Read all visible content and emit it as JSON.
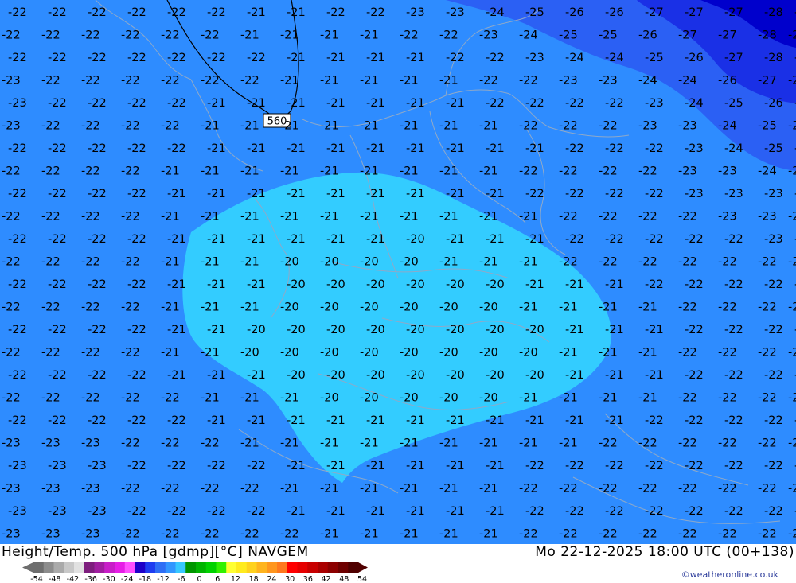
{
  "map": {
    "contour_label": "560",
    "columns": [
      2,
      52,
      102,
      152,
      202,
      252,
      302,
      352,
      402,
      452,
      502,
      552,
      602,
      652,
      702,
      752,
      802,
      852,
      902,
      952,
      990
    ],
    "rows": [
      [
        "-22",
        "-22",
        "-22",
        "-22",
        "-22",
        "-22",
        "-21",
        "-21",
        "-22",
        "-22",
        "-23",
        "-23",
        "-24",
        "-25",
        "-26",
        "-26",
        "-27",
        "-27",
        "-27",
        "-28",
        "-28"
      ],
      [
        "-22",
        "-22",
        "-22",
        "-22",
        "-22",
        "-22",
        "-21",
        "-21",
        "-21",
        "-21",
        "-22",
        "-22",
        "-23",
        "-24",
        "-25",
        "-25",
        "-26",
        "-27",
        "-27",
        "-28",
        "-28"
      ],
      [
        "-22",
        "-22",
        "-22",
        "-22",
        "-22",
        "-22",
        "-22",
        "-21",
        "-21",
        "-21",
        "-21",
        "-22",
        "-22",
        "-23",
        "-24",
        "-24",
        "-25",
        "-26",
        "-27",
        "-28",
        "-28"
      ],
      [
        "-23",
        "-22",
        "-22",
        "-22",
        "-22",
        "-22",
        "-22",
        "-21",
        "-21",
        "-21",
        "-21",
        "-21",
        "-22",
        "-22",
        "-23",
        "-23",
        "-24",
        "-24",
        "-26",
        "-27",
        "-27"
      ],
      [
        "-23",
        "-22",
        "-22",
        "-22",
        "-22",
        "-21",
        "-21",
        "-21",
        "-21",
        "-21",
        "-21",
        "-21",
        "-22",
        "-22",
        "-22",
        "-22",
        "-23",
        "-24",
        "-25",
        "-26",
        "-26"
      ],
      [
        "-23",
        "-22",
        "-22",
        "-22",
        "-22",
        "-21",
        "-21",
        "-21",
        "-21",
        "-21",
        "-21",
        "-21",
        "-21",
        "-22",
        "-22",
        "-22",
        "-23",
        "-23",
        "-24",
        "-25",
        "-26"
      ],
      [
        "-22",
        "-22",
        "-22",
        "-22",
        "-22",
        "-21",
        "-21",
        "-21",
        "-21",
        "-21",
        "-21",
        "-21",
        "-21",
        "-21",
        "-22",
        "-22",
        "-22",
        "-23",
        "-24",
        "-25",
        "-25"
      ],
      [
        "-22",
        "-22",
        "-22",
        "-22",
        "-21",
        "-21",
        "-21",
        "-21",
        "-21",
        "-21",
        "-21",
        "-21",
        "-21",
        "-22",
        "-22",
        "-22",
        "-22",
        "-23",
        "-23",
        "-24",
        "-24"
      ],
      [
        "-22",
        "-22",
        "-22",
        "-22",
        "-21",
        "-21",
        "-21",
        "-21",
        "-21",
        "-21",
        "-21",
        "-21",
        "-21",
        "-22",
        "-22",
        "-22",
        "-22",
        "-23",
        "-23",
        "-23",
        "-23"
      ],
      [
        "-22",
        "-22",
        "-22",
        "-22",
        "-21",
        "-21",
        "-21",
        "-21",
        "-21",
        "-21",
        "-21",
        "-21",
        "-21",
        "-21",
        "-22",
        "-22",
        "-22",
        "-22",
        "-23",
        "-23",
        "-23"
      ],
      [
        "-22",
        "-22",
        "-22",
        "-22",
        "-21",
        "-21",
        "-21",
        "-21",
        "-21",
        "-21",
        "-20",
        "-21",
        "-21",
        "-21",
        "-22",
        "-22",
        "-22",
        "-22",
        "-22",
        "-23",
        "-23"
      ],
      [
        "-22",
        "-22",
        "-22",
        "-22",
        "-21",
        "-21",
        "-21",
        "-20",
        "-20",
        "-20",
        "-20",
        "-21",
        "-21",
        "-21",
        "-22",
        "-22",
        "-22",
        "-22",
        "-22",
        "-22",
        "-23"
      ],
      [
        "-22",
        "-22",
        "-22",
        "-22",
        "-21",
        "-21",
        "-21",
        "-20",
        "-20",
        "-20",
        "-20",
        "-20",
        "-20",
        "-21",
        "-21",
        "-21",
        "-22",
        "-22",
        "-22",
        "-22",
        "-22"
      ],
      [
        "-22",
        "-22",
        "-22",
        "-22",
        "-21",
        "-21",
        "-21",
        "-20",
        "-20",
        "-20",
        "-20",
        "-20",
        "-20",
        "-21",
        "-21",
        "-21",
        "-21",
        "-22",
        "-22",
        "-22",
        "-22"
      ],
      [
        "-22",
        "-22",
        "-22",
        "-22",
        "-21",
        "-21",
        "-20",
        "-20",
        "-20",
        "-20",
        "-20",
        "-20",
        "-20",
        "-20",
        "-21",
        "-21",
        "-21",
        "-22",
        "-22",
        "-22",
        "-22"
      ],
      [
        "-22",
        "-22",
        "-22",
        "-22",
        "-21",
        "-21",
        "-20",
        "-20",
        "-20",
        "-20",
        "-20",
        "-20",
        "-20",
        "-20",
        "-21",
        "-21",
        "-21",
        "-22",
        "-22",
        "-22",
        "-23"
      ],
      [
        "-22",
        "-22",
        "-22",
        "-22",
        "-21",
        "-21",
        "-21",
        "-20",
        "-20",
        "-20",
        "-20",
        "-20",
        "-20",
        "-20",
        "-21",
        "-21",
        "-21",
        "-22",
        "-22",
        "-22",
        "-22"
      ],
      [
        "-22",
        "-22",
        "-22",
        "-22",
        "-22",
        "-21",
        "-21",
        "-21",
        "-20",
        "-20",
        "-20",
        "-20",
        "-20",
        "-21",
        "-21",
        "-21",
        "-21",
        "-22",
        "-22",
        "-22",
        "-22"
      ],
      [
        "-22",
        "-22",
        "-22",
        "-22",
        "-22",
        "-21",
        "-21",
        "-21",
        "-21",
        "-21",
        "-21",
        "-21",
        "-21",
        "-21",
        "-21",
        "-21",
        "-22",
        "-22",
        "-22",
        "-22",
        "-22"
      ],
      [
        "-23",
        "-23",
        "-23",
        "-22",
        "-22",
        "-22",
        "-21",
        "-21",
        "-21",
        "-21",
        "-21",
        "-21",
        "-21",
        "-21",
        "-21",
        "-22",
        "-22",
        "-22",
        "-22",
        "-22",
        "-22"
      ],
      [
        "-23",
        "-23",
        "-23",
        "-22",
        "-22",
        "-22",
        "-22",
        "-21",
        "-21",
        "-21",
        "-21",
        "-21",
        "-21",
        "-22",
        "-22",
        "-22",
        "-22",
        "-22",
        "-22",
        "-22",
        "-22"
      ],
      [
        "-23",
        "-23",
        "-23",
        "-22",
        "-22",
        "-22",
        "-22",
        "-21",
        "-21",
        "-21",
        "-21",
        "-21",
        "-21",
        "-22",
        "-22",
        "-22",
        "-22",
        "-22",
        "-22",
        "-22",
        "-22"
      ],
      [
        "-23",
        "-23",
        "-23",
        "-22",
        "-22",
        "-22",
        "-22",
        "-21",
        "-21",
        "-21",
        "-21",
        "-21",
        "-21",
        "-22",
        "-22",
        "-22",
        "-22",
        "-22",
        "-22",
        "-22",
        "-22"
      ],
      [
        "-23",
        "-23",
        "-23",
        "-22",
        "-22",
        "-22",
        "-22",
        "-22",
        "-21",
        "-21",
        "-21",
        "-21",
        "-21",
        "-22",
        "-22",
        "-22",
        "-22",
        "-22",
        "-22",
        "-22",
        "-22"
      ]
    ],
    "colors": {
      "band_minus_28": "#0000cc",
      "band_minus_26": "#1a30e6",
      "band_minus_24": "#2b60f4",
      "band_minus_22": "#2e8cff",
      "band_minus_20": "#33ccff",
      "land_borders": "#8fa9c8",
      "value_labels": "#000000"
    }
  },
  "title": {
    "left": "Height/Temp. 500 hPa [gdmp][°C] NAVGEM",
    "right": "Mo 22-12-2025 18:00 UTC (00+138)"
  },
  "legend": {
    "ticks": [
      "-54",
      "-48",
      "-42",
      "-36",
      "-30",
      "-24",
      "-18",
      "-12",
      "-6",
      "0",
      "6",
      "12",
      "18",
      "24",
      "30",
      "36",
      "42",
      "48",
      "54"
    ],
    "colors": [
      "#6e6e6e",
      "#8c8c8c",
      "#aaaaaa",
      "#c8c8c8",
      "#e1e1e1",
      "#7d1e7d",
      "#a01ea0",
      "#c81ec8",
      "#e61ee6",
      "#ff50ff",
      "#1e00c8",
      "#1e3cf0",
      "#2e6ef5",
      "#3296ff",
      "#37c8ff",
      "#009600",
      "#00b400",
      "#00d200",
      "#32f000",
      "#ffff32",
      "#ffeb1e",
      "#ffd21e",
      "#ffb41e",
      "#ff961e",
      "#ff781e",
      "#ff0000",
      "#e60000",
      "#c80000",
      "#aa0000",
      "#8c0000",
      "#6e0000",
      "#500000"
    ]
  },
  "credit": "©weatheronline.co.uk"
}
